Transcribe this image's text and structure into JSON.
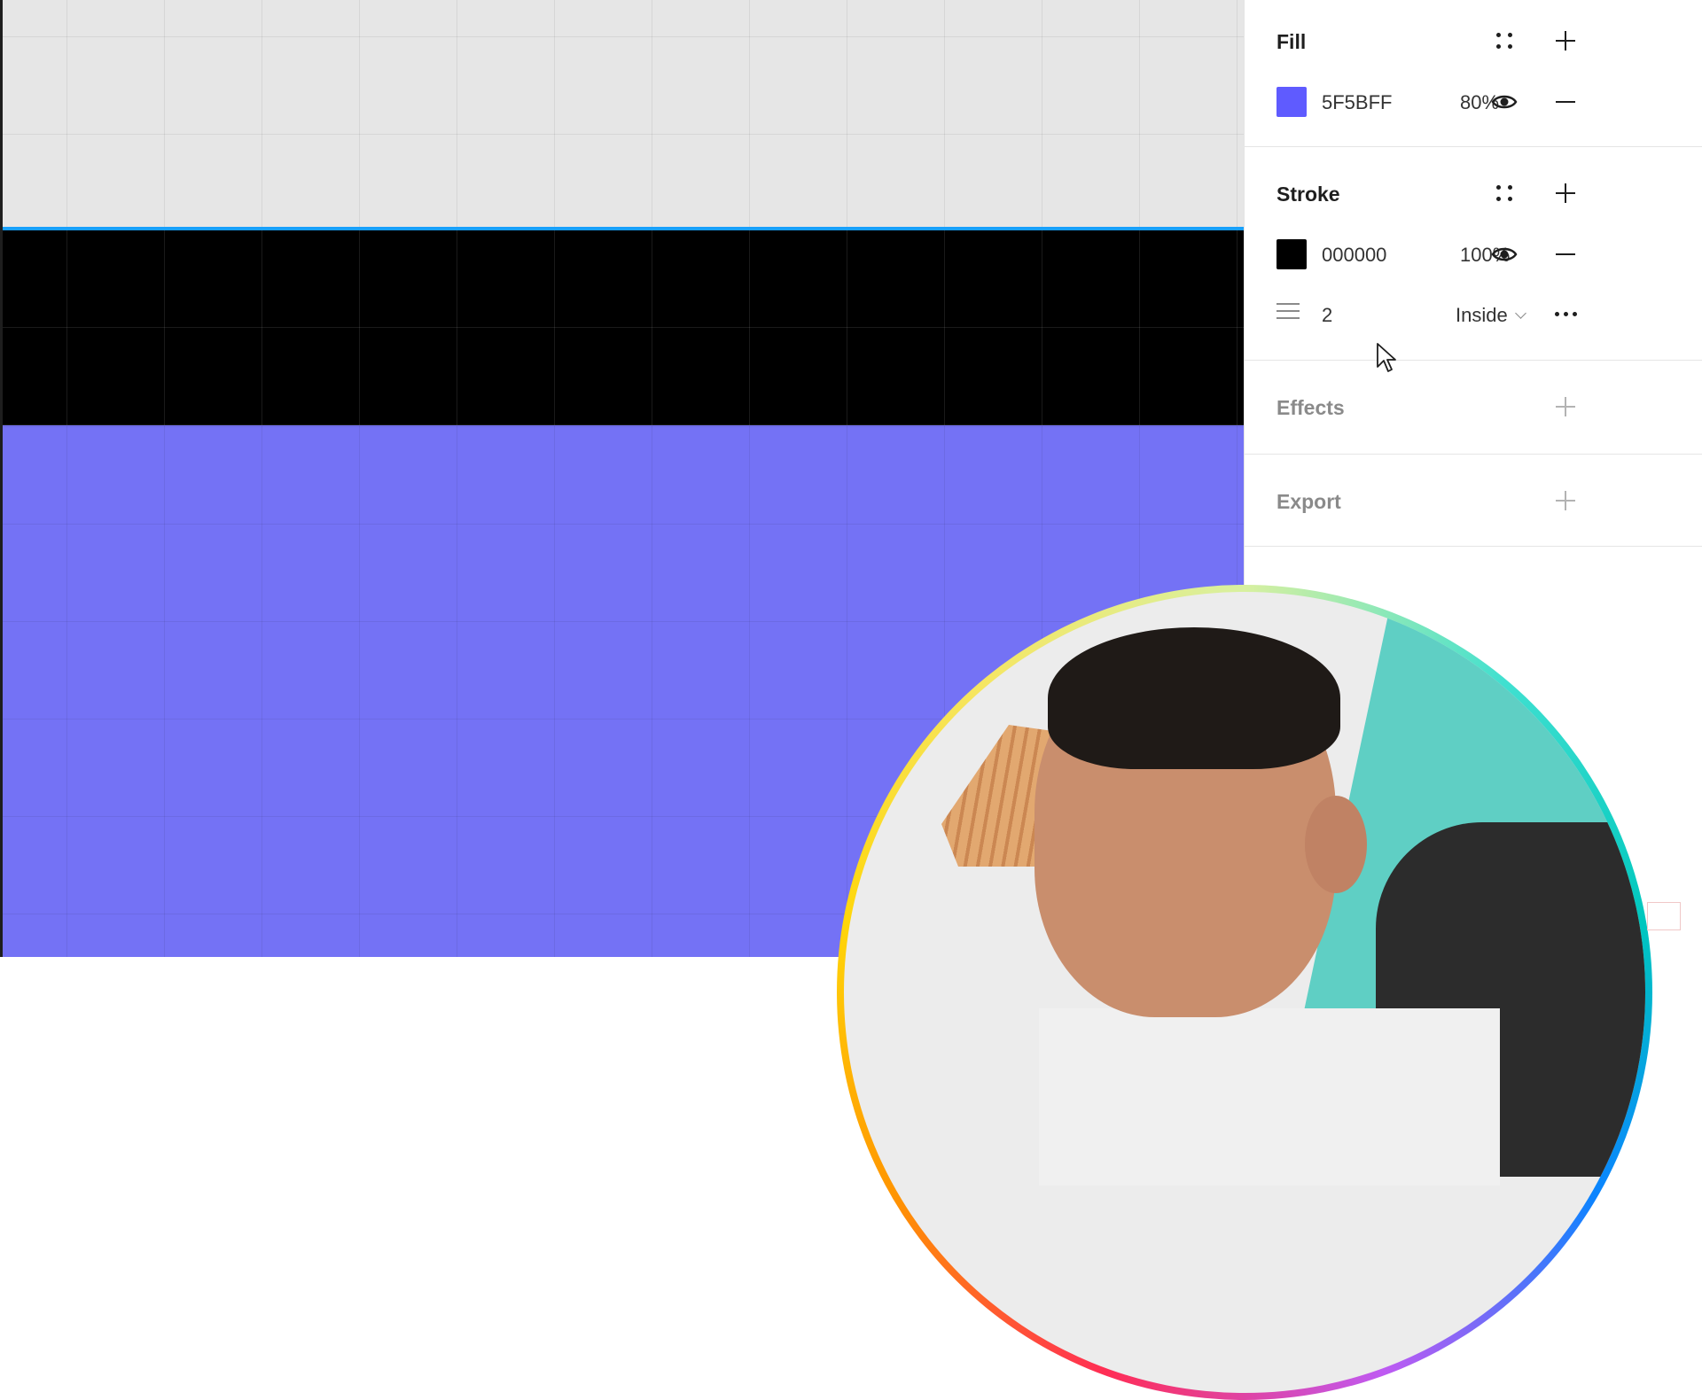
{
  "panel": {
    "fill": {
      "title": "Fill",
      "swatch_color": "#5F5BFF",
      "hex": "5F5BFF",
      "opacity": "80%"
    },
    "stroke": {
      "title": "Stroke",
      "swatch_color": "#000000",
      "hex": "000000",
      "opacity": "100%",
      "weight": "2",
      "position": "Inside"
    },
    "effects": {
      "title": "Effects"
    },
    "export": {
      "title": "Export"
    }
  },
  "canvas": {
    "colors": {
      "top_band": "#e6e6e6",
      "middle_band": "#000000",
      "bottom_band": "#7472f5",
      "selection": "#18a0fb"
    }
  },
  "icons": [
    "style-grid-icon",
    "plus-icon",
    "eye-icon",
    "minus-icon",
    "stroke-weight-icon",
    "chevron-down-icon",
    "more-icon",
    "cursor-icon"
  ]
}
